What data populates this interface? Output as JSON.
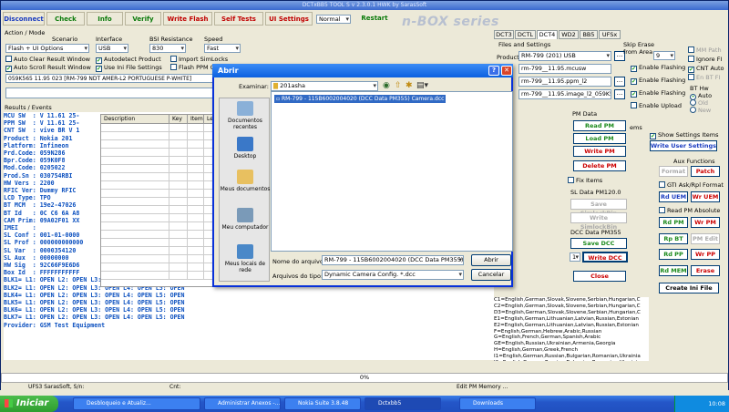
{
  "app": {
    "title": "DCTxBB5 TOOL S v 2.3.0.1 HWK by SarasSoft",
    "brand": "n-BOX series"
  },
  "toolbar": {
    "disconnect": "Disconnect",
    "check": "Check",
    "info": "Info",
    "verify": "Verify",
    "write_flash": "Write Flash",
    "self_tests": "Self Tests",
    "ui_settings": "UI Settings",
    "mode_value": "Normal",
    "restart": "Restart"
  },
  "action_mode": {
    "group_label": "Action / Mode",
    "scenario_label": "Scenario",
    "scenario_value": "Flash + UI Options",
    "interface_label": "Interface",
    "interface_value": "USB",
    "bsi_label": "BSI Resistance",
    "bsi_value": "830",
    "speed_label": "Speed",
    "speed_value": "Fast",
    "cb_auto_clear": "Auto Clear Result Window",
    "cb_auto_scroll": "Auto Scroll Result Window",
    "cb_autodetect": "Autodetect Product",
    "cb_use_ini": "Use Ini File Settings",
    "cb_import_simlocks": "Import SimLocks",
    "cb_flash_ppm": "Flash PPM Or",
    "info_line": "059K565 11.95 023 [RM-799 NDT AMER-L2 PORTUGUESE P-WHITE]"
  },
  "results": {
    "group_label": "Results / Events",
    "lines": [
      "MCU SW  : V 11.61 25-",
      "PPM SW  : V 11.61 25-",
      "CNT SW  : vive BR V 1",
      "Product : Nokia 201",
      "Platform: Infineon",
      "Prd.Code: 059N286",
      "Bpr.Code: 059K0F8",
      "Mod.Code: 0205022",
      "Prod.Sn : 030754RBI",
      "HW Vers : 2200",
      "RFIC Ver: Dummy RFIC",
      "LCD Type: TPO",
      "BT MCM  : 19e2-47026",
      "BT Id   : 0C C6 6A A8",
      "CAM Prim: 09A02F01 XX",
      "IMEI    : ",
      "SL Conf : 001-01-0000",
      "SL Prof : 000000000000",
      "SL Var  : 0000354120",
      "SL Aux  : 00000000",
      "HW Sig  : 92C66F9E6D6",
      "Box Id  : FFFFFFFFFFF",
      "BLK1= L1: OPEN L2: OPEN L3: OPEN L4: OPEN L5: OPEN",
      "BLK2= L1: OPEN L2: OPEN L3: OPEN L4: OPEN L5: OPEN",
      "BLK4= L1: OPEN L2: OPEN L3: OPEN L4: OPEN L5: OPEN",
      "BLK5= L1: OPEN L2: OPEN L3: OPEN L4: OPEN L5: OPEN",
      "BLK6= L1: OPEN L2: OPEN L3: OPEN L4: OPEN L5: OPEN",
      "BLK7= L1: OPEN L2: OPEN L3: OPEN L4: OPEN L5: OPEN",
      "Provider: GSM Test Equipment"
    ],
    "grid_headers": [
      "Description",
      "Key",
      "Item",
      "Lev"
    ]
  },
  "languages": [
    "C1=English,German,Slovak,Slovene,Serbian,Hungarian,C",
    "C2=English,German,Slovak,Slovene,Serbian,Hungarian,C",
    "D3=English,German,Slovak,Slovene,Serbian,Hungarian,C",
    "E1=English,German,Lithuanian,Latvian,Russian,Estonian",
    "E2=English,German,Lithuanian,Latvian,Russian,Estonian",
    "F=English,German,Hebrew,Arabic,Russian",
    "G=English,French,German,Spanish,Arabic",
    "GE=English,Russian,Ukrainian,Armenia,Georgia",
    "H=English,German,Greek,French",
    "I1=English,German,Russian,Bulgarian,Romanian,Ukrainia",
    "I2=English,German,Russian,Bulgarian,Romanian,Ukrainia"
  ],
  "tabs": [
    "DCT3",
    "DCTL",
    "DCT4",
    "WD2",
    "BB5",
    "UFSx"
  ],
  "files": {
    "group_label": "Files and Settings",
    "product_label": "Product",
    "product_value": "RM-799  (201) USB",
    "mcu_file": "rm-799__11.95.mcusw",
    "ppm_file": "rm-799__11.95.ppm_l2",
    "image_file": "rm-799__11.95.image_l2_059K565",
    "skip_erase_label": "Skip Erase from Area",
    "skip_value": "9",
    "cb_flash1": "Enable Flashing",
    "cb_flash2": "Enable Flashing",
    "cb_flash3": "Enable Flashing",
    "cb_upload": "Enable Upload"
  },
  "right_options": {
    "mm_path": "MM Path",
    "ignore_fi": "Ignore FI",
    "cnt_auto": "CNT Auto",
    "en_bt_fi": "En BT FI",
    "bt_hw_label": "BT Hw",
    "bt_auto": "Auto",
    "bt_old": "Old",
    "bt_new": "New",
    "items_label": "ems",
    "show_settings": "Show Settings Items",
    "write_user_settings": "Write User Settings"
  },
  "pm_data": {
    "group_label": "PM Data",
    "read_pm": "Read PM",
    "load_pm": "Load PM",
    "write_pm": "Write PM",
    "delete_pm": "Delete PM",
    "fix_items": "Fix Items",
    "sl_data_label": "SL Data PM120.0",
    "save_simlock": "Save SimlockBin",
    "write_simlock": "Write SimlockBin",
    "dcc_label": "DCC Data PM355",
    "save_dcc": "Save DCC",
    "dcc_count": "1",
    "write_dcc": "Write DCC",
    "close": "Close"
  },
  "aux": {
    "group_label": "Aux Functions",
    "format": "Format",
    "patch": "Patch",
    "gti_label": "GTI Ask/Rpl Format",
    "rd_uem": "Rd UEM",
    "wr_uem": "Wr UEM",
    "read_pm_abs": "Read PM Absolute",
    "rd_pm": "Rd PM",
    "wr_pm": "Wr PM",
    "rp_bt": "Rp BT",
    "pm_edit": "PM Edit",
    "rd_pp": "Rd PP",
    "wr_pp": "Wr PP",
    "rd_mem": "Rd MEM",
    "erase": "Erase",
    "create_ini": "Create Ini File"
  },
  "progress": "0%",
  "status": {
    "left": "UFS3 SarasSoft, S/n:",
    "cnt": "Cnt:",
    "right": "Edit PM Memory ..."
  },
  "dialog": {
    "title": "Abrir",
    "lookin_label": "Examinar:",
    "lookin_value": "201asha",
    "file_item": "RM-799 - 115B6002004020 (DCC Data PM355) Camera.dcc",
    "places": [
      "Documentos recentes",
      "Desktop",
      "Meus documentos",
      "Meu computador",
      "Meus locais de rede"
    ],
    "filename_label": "Nome do arquivo:",
    "filename_value": "RM-799 - 115B6002004020 (DCC Data PM355) Ca",
    "filetype_label": "Arquivos do tipo:",
    "filetype_value": "Dynamic Camera Config. *.dcc",
    "open": "Abrir",
    "cancel": "Cancelar"
  },
  "taskbar": {
    "start": "Iniciar",
    "tasks": [
      "Desbloqueio e Atualiz...",
      "Administrar Anexos -...",
      "Nokia Suite 3.8.48",
      "Dctxbb5",
      "Downloads"
    ],
    "clock": "10:08"
  },
  "colors": {
    "green": "#1c8a1c",
    "red": "#c00000",
    "blue": "#1a3cc0",
    "console_text": "#0a4fbf",
    "xp_blue": "#2456c8"
  }
}
